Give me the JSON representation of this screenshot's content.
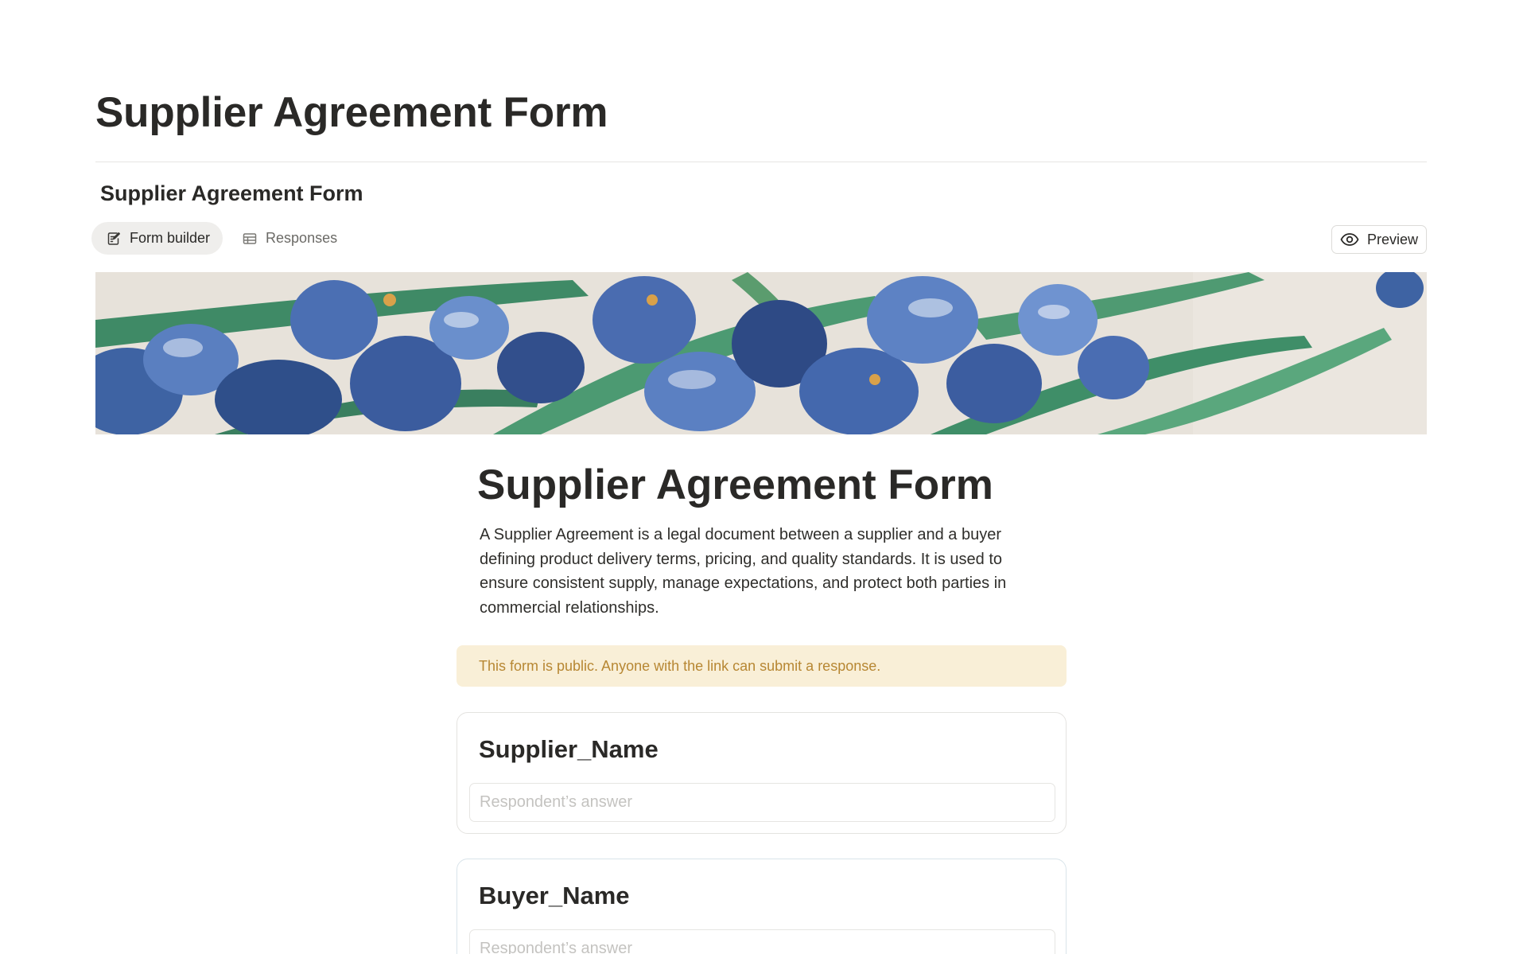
{
  "page": {
    "title": "Supplier Agreement Form"
  },
  "database": {
    "title": "Supplier Agreement Form"
  },
  "tabs": [
    {
      "label": "Form builder",
      "icon": "form-edit-icon",
      "active": true
    },
    {
      "label": "Responses",
      "icon": "table-icon",
      "active": false
    }
  ],
  "preview": {
    "label": "Preview",
    "icon": "eye-icon"
  },
  "form": {
    "title": "Supplier Agreement Form",
    "description": "A Supplier Agreement is a legal document between a supplier and a buyer defining product delivery terms, pricing, and quality standards. It is used to ensure consistent supply, manage expectations, and protect both parties in commercial relationships.",
    "public_notice": "This form is public. Anyone with the link can submit a response.",
    "questions": [
      {
        "label": "Supplier_Name",
        "placeholder": "Respondent’s answer"
      },
      {
        "label": "Buyer_Name",
        "placeholder": "Respondent’s answer"
      }
    ]
  },
  "colors": {
    "text": "#2a2927",
    "notice_bg": "#f9efd7",
    "notice_text": "#b78733",
    "active_tab_bg": "#efeeec"
  }
}
